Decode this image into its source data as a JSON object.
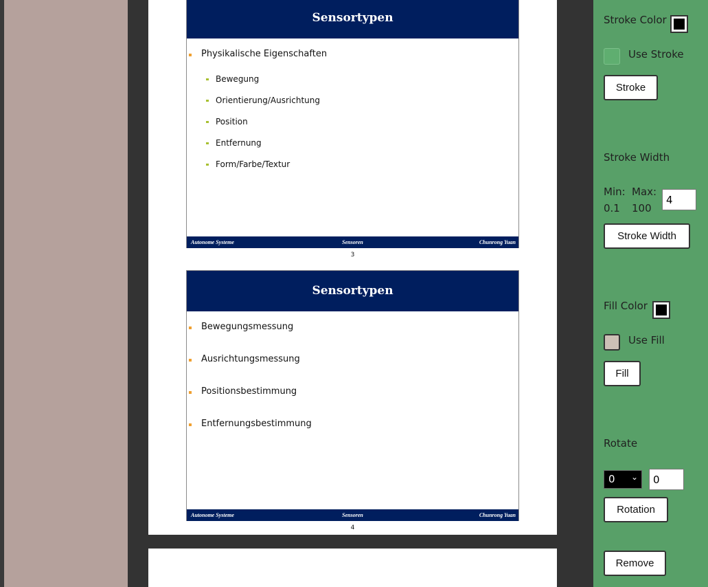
{
  "slides": [
    {
      "title": "Sensortypen",
      "items": [
        {
          "text": "Physikalische Eigenschaften",
          "level": 1
        },
        {
          "text": "Bewegung",
          "level": 2
        },
        {
          "text": "Orientierung/Ausrichtung",
          "level": 2
        },
        {
          "text": "Position",
          "level": 2
        },
        {
          "text": "Entfernung",
          "level": 2
        },
        {
          "text": "Form/Farbe/Textur",
          "level": 2
        }
      ],
      "footer": {
        "left": "Autonome Systeme",
        "center": "Sensoren",
        "right": "Chunrong Yuan"
      },
      "page_number": "3"
    },
    {
      "title": "Sensortypen",
      "items": [
        {
          "text": "Bewegungsmessung",
          "level": 1
        },
        {
          "text": "Ausrichtungsmessung",
          "level": 1
        },
        {
          "text": "Positionsbestimmung",
          "level": 1
        },
        {
          "text": "Entfernungsbestimmung",
          "level": 1
        }
      ],
      "footer": {
        "left": "Autonome Systeme",
        "center": "Sensoren",
        "right": "Chunrong Yuan"
      },
      "page_number": "4"
    }
  ],
  "panel": {
    "stroke_color_label": "Stroke Color",
    "stroke_color": "#000000",
    "use_stroke_label": "Use Stroke",
    "use_stroke_checked": false,
    "stroke_button": "Stroke",
    "stroke_width_label": "Stroke Width",
    "min_label": "Min:",
    "min_value": "0.1",
    "max_label": "Max:",
    "max_value": "100",
    "stroke_width_value": "4",
    "stroke_width_button": "Stroke Width",
    "fill_color_label": "Fill Color",
    "fill_color": "#000000",
    "use_fill_label": "Use Fill",
    "use_fill_checked": false,
    "fill_button": "Fill",
    "rotate_label": "Rotate",
    "rotate_select_value": "0",
    "rotate_input_value": "0",
    "rotation_button": "Rotation",
    "remove_button": "Remove"
  },
  "colors": {
    "left_panel": "#b5a19c",
    "right_panel": "#58a068",
    "slide_header": "#001e5e",
    "background": "#333333"
  }
}
